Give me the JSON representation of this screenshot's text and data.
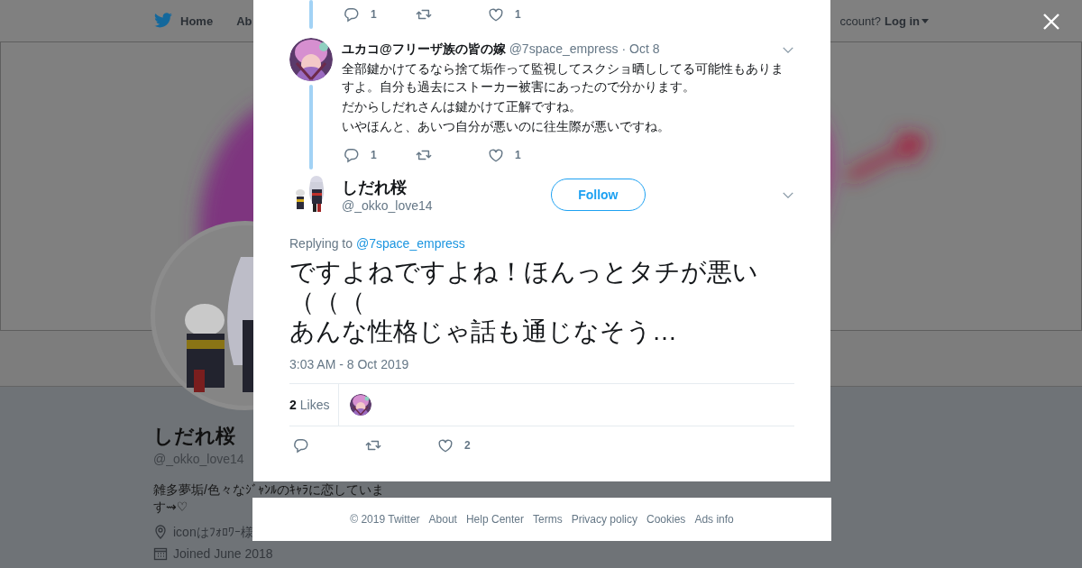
{
  "page": {
    "nav": [
      {
        "label": "Home",
        "kind": "home"
      },
      {
        "label": "Ab",
        "kind": "plain"
      }
    ],
    "account_prompt": "ccount?",
    "login": "Log in",
    "profile": {
      "name": "しだれ桜",
      "handle": "@_okko_love14",
      "bio_lines": [
        "雑多夢垢/色々なｼﾞｬﾝﾙのｷｬﾗに恋していま",
        "す⇝♡"
      ],
      "location": "iconはﾌｫﾛﾜｰ様",
      "joined": "Joined June 2018"
    }
  },
  "modal": {
    "thread": [
      {
        "kind": "partial",
        "actions": {
          "replies": "1",
          "likes": "1"
        }
      },
      {
        "kind": "tweet",
        "name": "ユカコ@フリーザ族の皆の嫁",
        "handle": "@7space_empress",
        "date": "· Oct 8",
        "text": [
          "全部鍵かけてるなら捨て垢作って監視してスクショ晒ししてる可能性もありますよ。自分も過去にストーカー被害にあったので分かります。",
          "だからしだれさんは鍵かけて正解ですね。",
          "いやほんと、あいつ自分が悪いのに往生際が悪いですね。"
        ],
        "actions": {
          "replies": "1",
          "likes": "1"
        }
      }
    ],
    "tweet": {
      "name": "しだれ桜",
      "handle": "@_okko_love14",
      "follow": "Follow",
      "replying_label": "Replying to",
      "replying_to": "@7space_empress",
      "text": [
        "ですよねですよね！ほんっとタチが悪い（（（",
        "あんな性格じゃ話も通じなそう…"
      ],
      "time": "3:03 AM - 8 Oct 2019",
      "likes_count": "2",
      "likes_label": "Likes",
      "liked_by": [
        {
          "kind": "picture"
        }
      ],
      "actions": {
        "likes": "2"
      }
    }
  },
  "footer": [
    "© 2019 Twitter",
    "About",
    "Help Center",
    "Terms",
    "Privacy policy",
    "Cookies",
    "Ads info"
  ]
}
